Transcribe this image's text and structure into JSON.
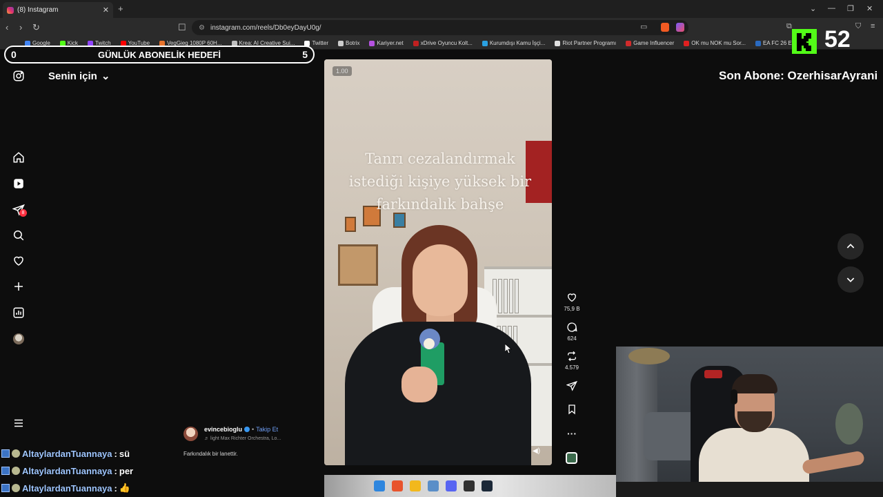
{
  "browser": {
    "tab_title": "(8) Instagram",
    "url": "instagram.com/reels/Db0eyDayU0g/",
    "bookmarks": [
      "Google",
      "Kick",
      "Twitch",
      "YouTube",
      "VegGieg 1080P 60H...",
      "Krea: AI Creative Sui...",
      "Twitter",
      "Botrix",
      "Kariyer.net",
      "xDrive Oyuncu Kolt...",
      "Kurumdışı Kamu İşçi...",
      "Riot Partner Programı",
      "Game Influencer",
      "OK mu NOK mu Sor...",
      "EA FC 26 Ev..."
    ],
    "bookmark_colors": [
      "#4285f4",
      "#53fc18",
      "#9146ff",
      "#ff0000",
      "#e8742d",
      "#c0c0c0",
      "#ffffff",
      "#cccccc",
      "#b552e0",
      "#c02020",
      "#2aa0e0",
      "#e0e0e0",
      "#d12b2b",
      "#e02020",
      "#2a6ac0"
    ]
  },
  "stream_overlay": {
    "goal_left": "0",
    "goal_title": "GÜNLÜK ABONELİK HEDEFİ",
    "goal_right": "5",
    "viewer_count": "52",
    "last_sub": "Son Abone: OzerhisarAyrani",
    "kick_color": "#53fc18"
  },
  "instagram": {
    "feed_label": "Senin için",
    "notification_badge": "8",
    "reel": {
      "speed": "1.00",
      "overlay_text": "Tanrı cezalandırmak istediği kişiye yüksek bir farkındalık bahşe",
      "username": "evincebioglu",
      "follow_label": "Takip Et",
      "music": "light  Max Richter Orchestra, Lo...",
      "caption": "Farkındalık bir lanettir."
    },
    "actions": {
      "likes": "75,9 B",
      "comments": "624",
      "reposts": "4.579"
    }
  },
  "chat": [
    {
      "user": "AltaylardanTuannaya",
      "message": "sü"
    },
    {
      "user": "AltaylardanTuannaya",
      "message": "per"
    },
    {
      "user": "AltaylardanTuannaya",
      "message": "👍"
    }
  ],
  "taskbar_icon_colors": [
    "#2e86de",
    "#e8542d",
    "#f2b81c",
    "#5a8ec8",
    "#5865f2",
    "#303030",
    "#1b2838"
  ]
}
